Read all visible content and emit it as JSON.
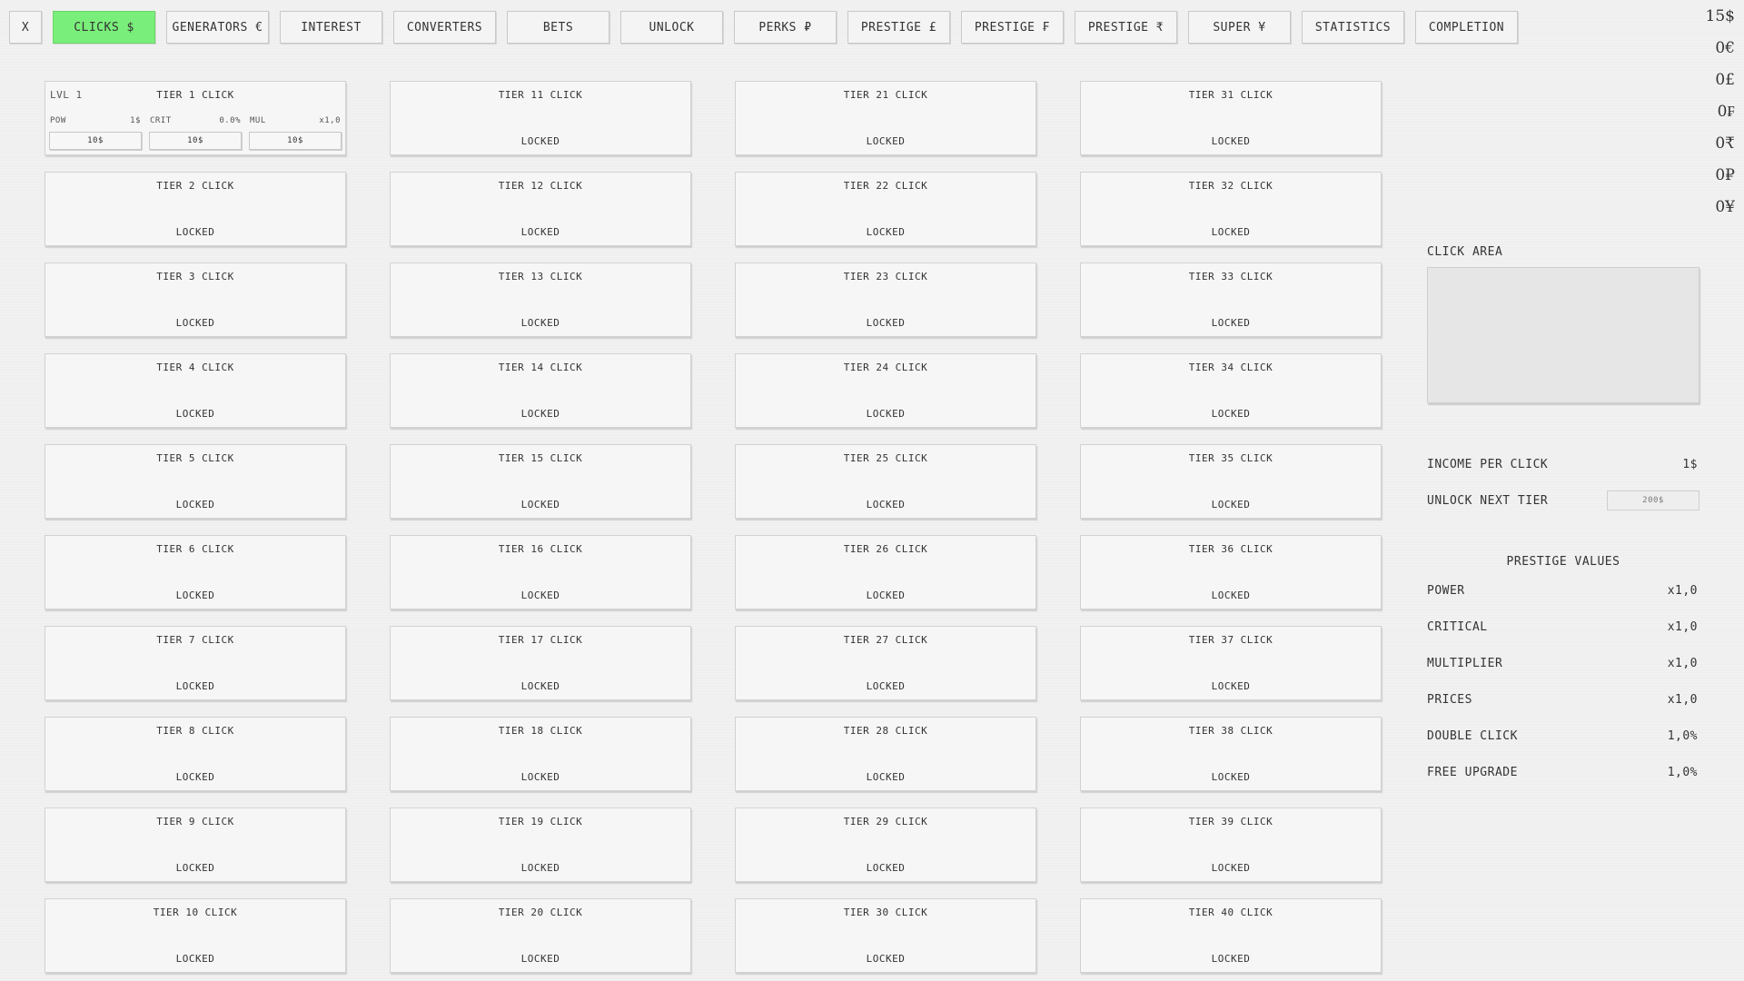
{
  "nav": [
    {
      "label": "X",
      "name": "close-button",
      "active": false
    },
    {
      "label": "CLICKS $",
      "name": "tab-clicks",
      "active": true
    },
    {
      "label": "GENERATORS €",
      "name": "tab-generators",
      "active": false
    },
    {
      "label": "INTEREST",
      "name": "tab-interest",
      "active": false
    },
    {
      "label": "CONVERTERS",
      "name": "tab-converters",
      "active": false
    },
    {
      "label": "BETS",
      "name": "tab-bets",
      "active": false
    },
    {
      "label": "UNLOCK",
      "name": "tab-unlock",
      "active": false
    },
    {
      "label": "PERKS ₽",
      "name": "tab-perks",
      "active": false
    },
    {
      "label": "PRESTIGE £",
      "name": "tab-prestige-pound",
      "active": false
    },
    {
      "label": "PRESTIGE ₣",
      "name": "tab-prestige-franc",
      "active": false
    },
    {
      "label": "PRESTIGE ₹",
      "name": "tab-prestige-rupee",
      "active": false
    },
    {
      "label": "SUPER ¥",
      "name": "tab-super",
      "active": false
    },
    {
      "label": "STATISTICS",
      "name": "tab-statistics",
      "active": false
    },
    {
      "label": "COMPLETION",
      "name": "tab-completion",
      "active": false
    }
  ],
  "currencies": [
    "15$",
    "0€",
    "0£",
    "0₣",
    "0₹",
    "0₽",
    "0¥"
  ],
  "tier1": {
    "level": "LVL 1",
    "title": "TIER 1 CLICK",
    "stats": [
      {
        "label": "POW",
        "value": "1$"
      },
      {
        "label": "CRIT",
        "value": "0.0%"
      },
      {
        "label": "MUL",
        "value": "x1,0"
      }
    ],
    "upgrades": [
      "10$",
      "10$",
      "10$"
    ]
  },
  "tiers": [
    "TIER 2 CLICK",
    "TIER 3 CLICK",
    "TIER 4 CLICK",
    "TIER 5 CLICK",
    "TIER 6 CLICK",
    "TIER 7 CLICK",
    "TIER 8 CLICK",
    "TIER 9 CLICK",
    "TIER 10 CLICK",
    "TIER 11 CLICK",
    "TIER 12 CLICK",
    "TIER 13 CLICK",
    "TIER 14 CLICK",
    "TIER 15 CLICK",
    "TIER 16 CLICK",
    "TIER 17 CLICK",
    "TIER 18 CLICK",
    "TIER 19 CLICK",
    "TIER 20 CLICK",
    "TIER 21 CLICK",
    "TIER 22 CLICK",
    "TIER 23 CLICK",
    "TIER 24 CLICK",
    "TIER 25 CLICK",
    "TIER 26 CLICK",
    "TIER 27 CLICK",
    "TIER 28 CLICK",
    "TIER 29 CLICK",
    "TIER 30 CLICK",
    "TIER 31 CLICK",
    "TIER 32 CLICK",
    "TIER 33 CLICK",
    "TIER 34 CLICK",
    "TIER 35 CLICK",
    "TIER 36 CLICK",
    "TIER 37 CLICK",
    "TIER 38 CLICK",
    "TIER 39 CLICK",
    "TIER 40 CLICK"
  ],
  "locked_label": "LOCKED",
  "panel": {
    "click_area_label": "CLICK AREA",
    "income_label": "INCOME PER CLICK",
    "income_value": "1$",
    "unlock_label": "UNLOCK NEXT TIER",
    "unlock_cost": "200$",
    "prestige_title": "PRESTIGE VALUES",
    "prestige": [
      {
        "label": "POWER",
        "value": "x1,0"
      },
      {
        "label": "CRITICAL",
        "value": "x1,0"
      },
      {
        "label": "MULTIPLIER",
        "value": "x1,0"
      },
      {
        "label": "PRICES",
        "value": "x1,0"
      },
      {
        "label": "DOUBLE CLICK",
        "value": "1,0%"
      },
      {
        "label": "FREE UPGRADE",
        "value": "1,0%"
      }
    ]
  }
}
